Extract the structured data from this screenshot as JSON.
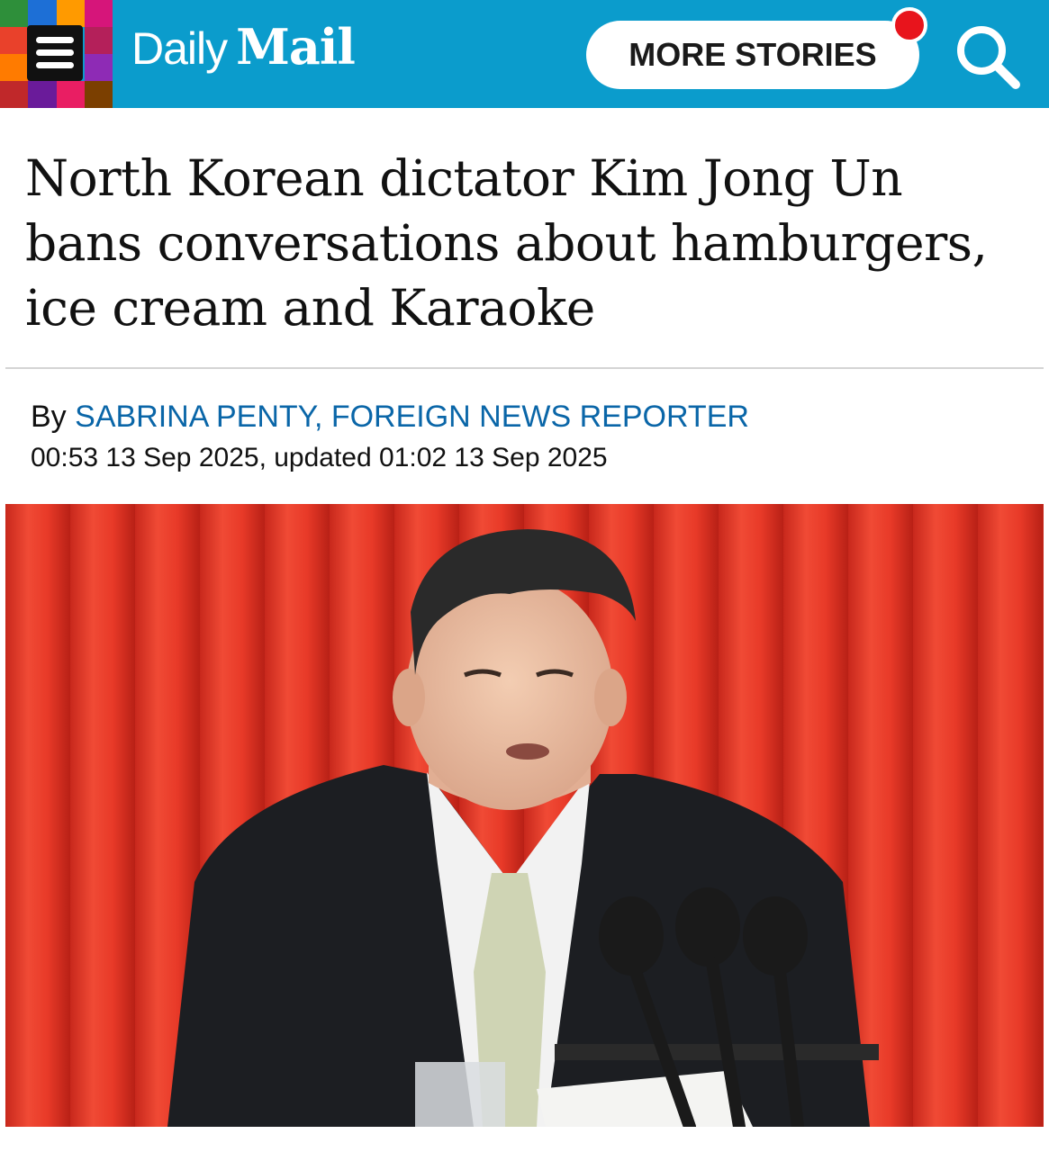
{
  "header": {
    "brand_daily": "Daily",
    "brand_mail": "Mail",
    "more_stories_label": "MORE STORIES",
    "brand_color": "#0b9ccc",
    "notification_color": "#e8141c",
    "icons": [
      "menu-icon",
      "search-icon",
      "notification-dot"
    ]
  },
  "article": {
    "headline_lines": [
      "North Korean dictator Kim Jong Un",
      "bans conversations about hamburgers,",
      "ice cream and Karaoke"
    ],
    "byline_prefix": "By",
    "author": "SABRINA PENTY, FOREIGN NEWS REPORTER",
    "timestamp": "00:53 13 Sep 2025, updated 01:02 13 Sep 2025",
    "author_color": "#0a66a8"
  }
}
